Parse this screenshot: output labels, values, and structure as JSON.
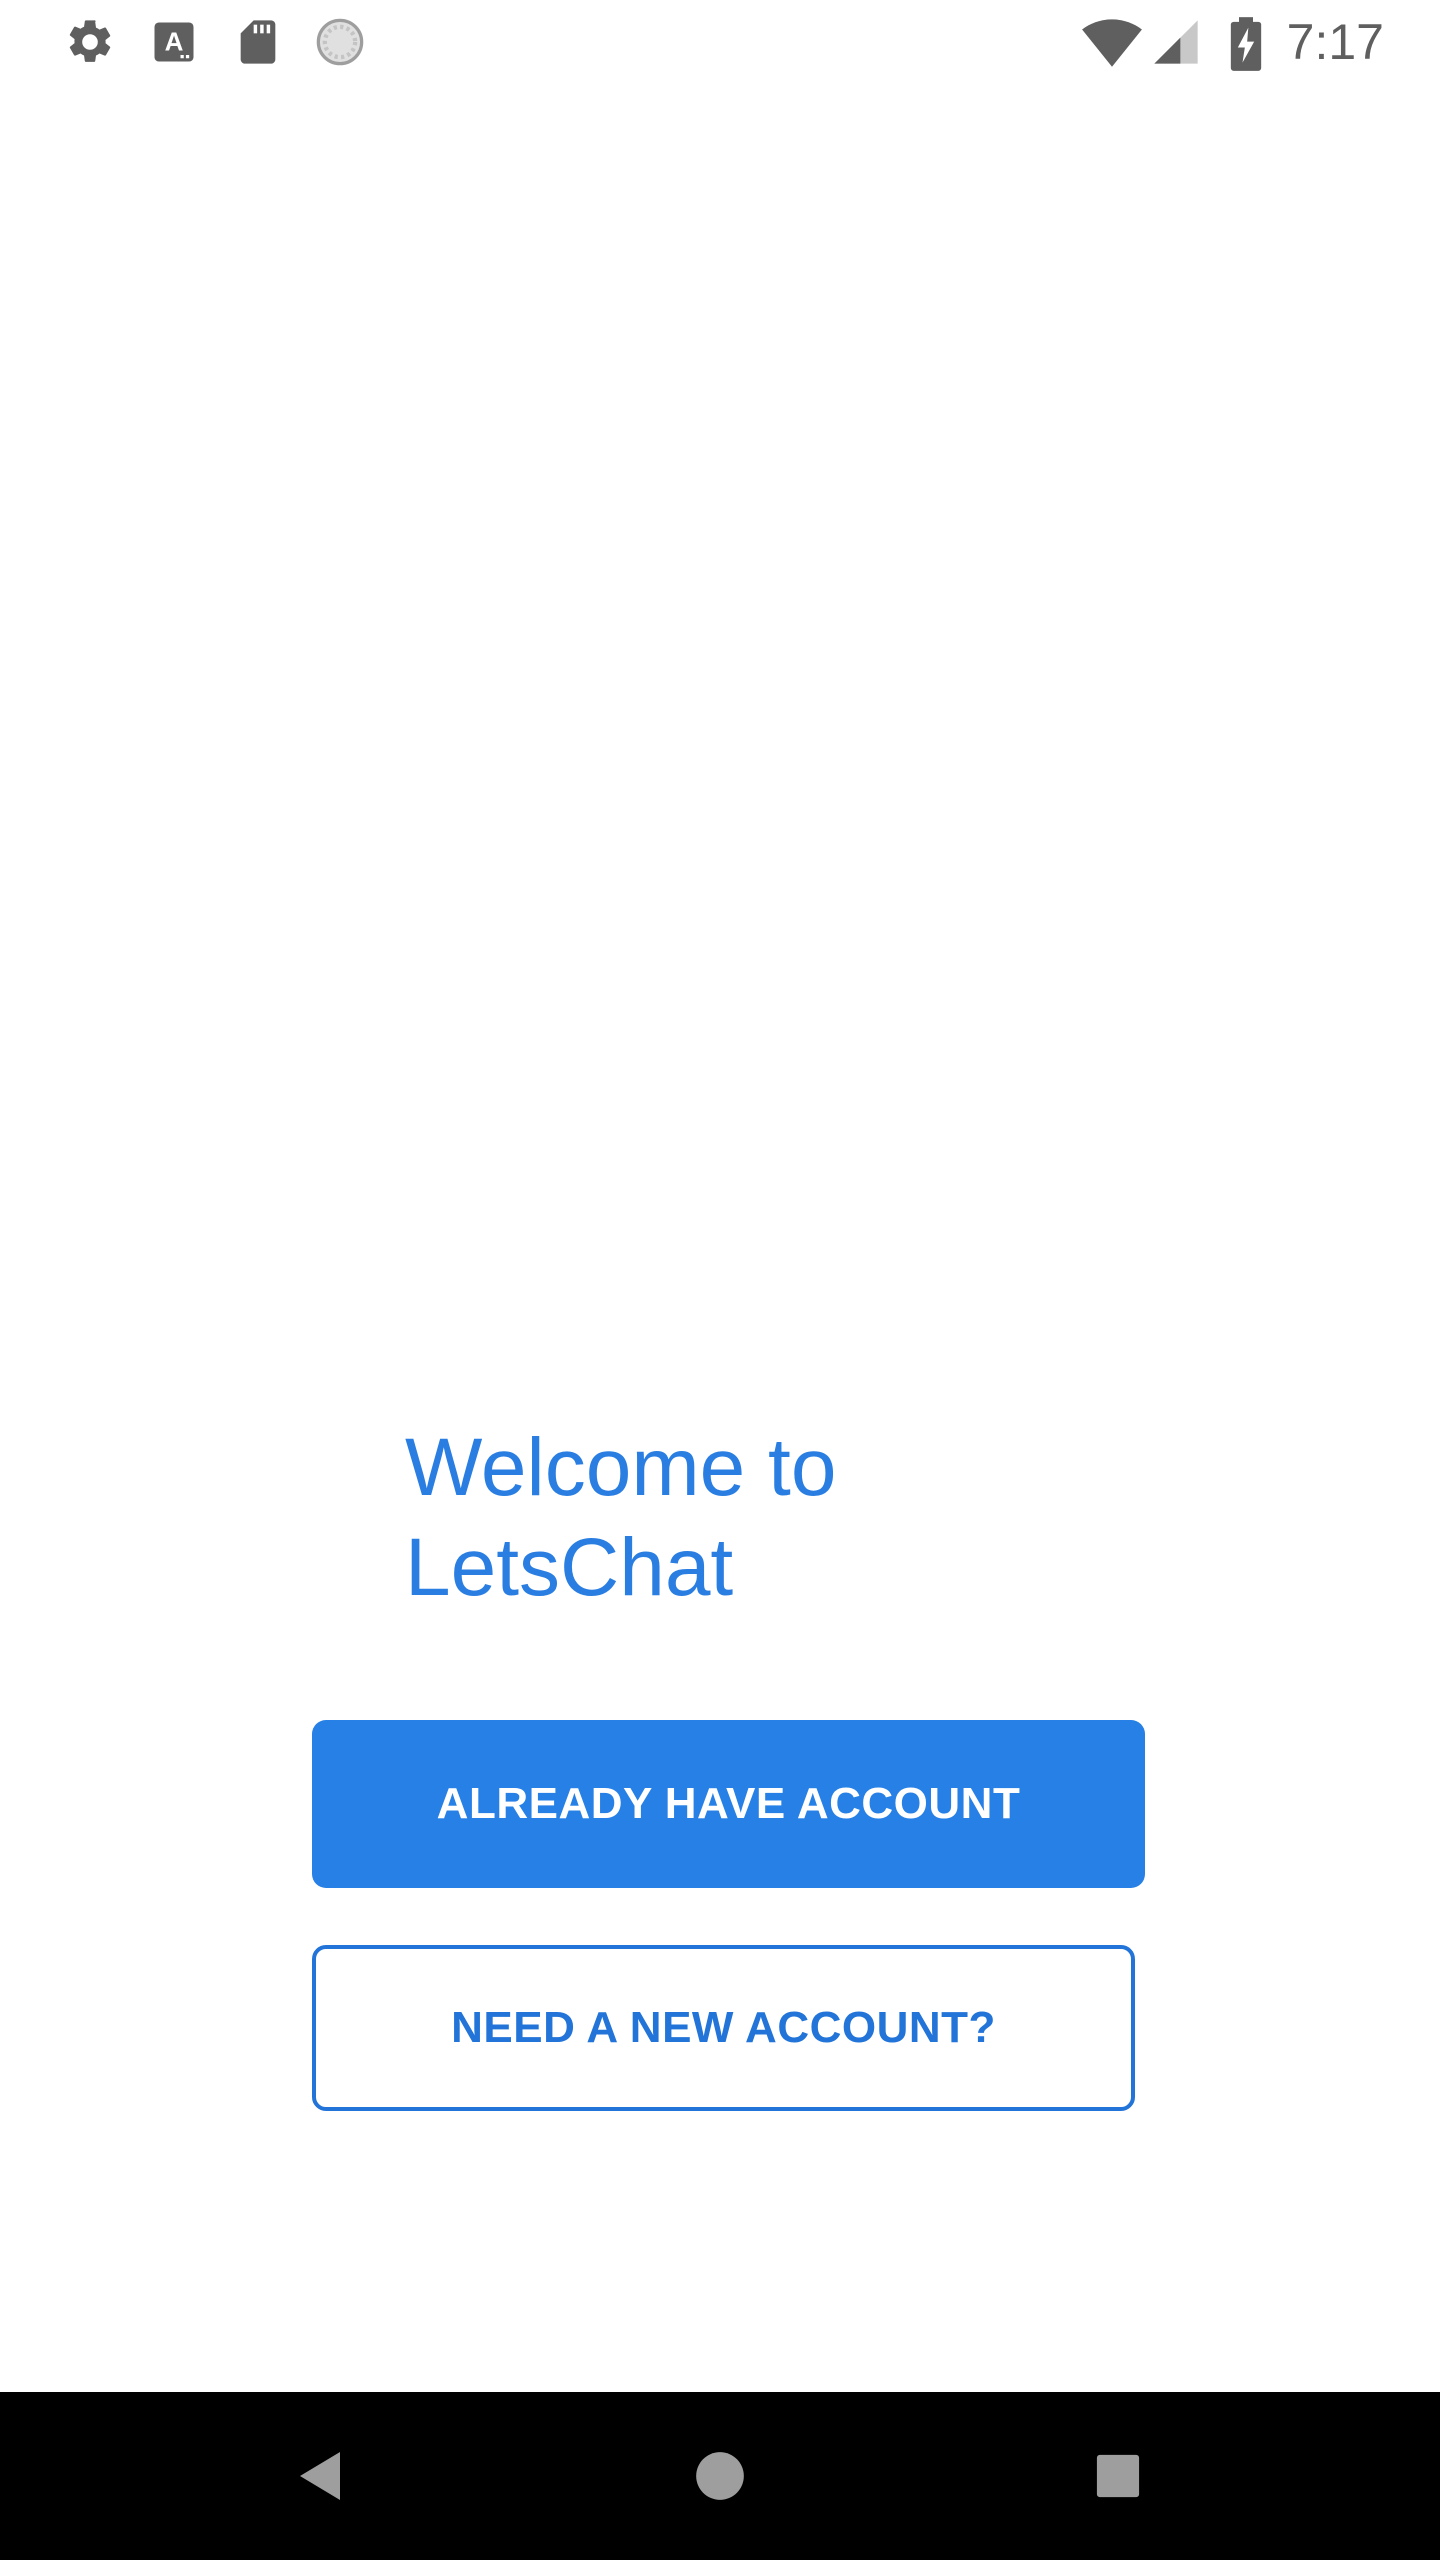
{
  "status_bar": {
    "time": "7:17",
    "left_icons": [
      "gear-icon",
      "text-a-icon",
      "sd-card-icon",
      "loading-circle-icon"
    ],
    "right_icons": [
      "wifi-icon",
      "cellular-signal-icon",
      "battery-charging-icon"
    ]
  },
  "main": {
    "welcome_text": "Welcome to LetsChat",
    "primary_button_label": "ALREADY HAVE ACCOUNT",
    "secondary_button_label": "NEED A NEW ACCOUNT?"
  },
  "nav_bar": {
    "buttons": [
      "back-icon",
      "home-icon",
      "recents-icon"
    ]
  },
  "colors": {
    "accent": "#2680e6",
    "welcome_text": "#2a7ee2",
    "status_icons": "#5f5f5f",
    "nav_bar_bg": "#000000"
  }
}
